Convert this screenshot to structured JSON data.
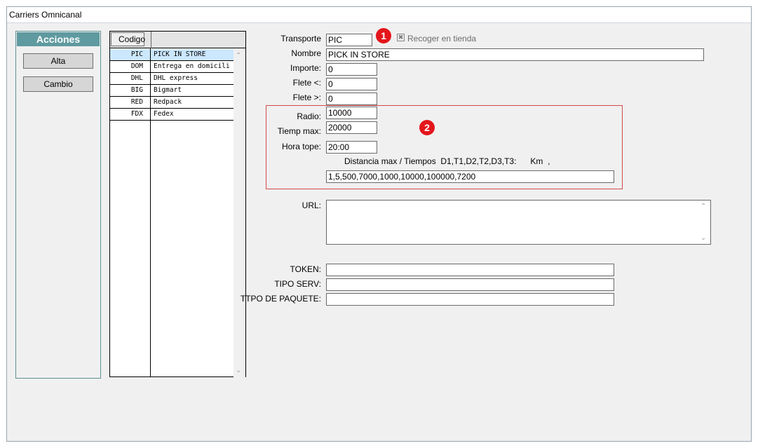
{
  "window": {
    "title": "Carriers Omnicanal"
  },
  "acciones": {
    "header": "Acciones",
    "buttons": {
      "alta": "Alta",
      "cambio": "Cambio"
    }
  },
  "list": {
    "column_header": "Codigo",
    "rows": [
      {
        "code": "PIC",
        "name": "PICK IN STORE"
      },
      {
        "code": "DOM",
        "name": "Entrega en domicili"
      },
      {
        "code": "DHL",
        "name": "DHL express"
      },
      {
        "code": "BIG",
        "name": "Bigmart"
      },
      {
        "code": "RED",
        "name": "Redpack"
      },
      {
        "code": "FDX",
        "name": "Fedex"
      }
    ],
    "selected_index": 0
  },
  "form": {
    "transporte": {
      "label": "Transporte",
      "value": "PIC"
    },
    "recoger": {
      "label": "Recoger en tienda",
      "checked": true
    },
    "nombre": {
      "label": "Nombre",
      "value": "PICK IN STORE"
    },
    "importe": {
      "label": "Importe:",
      "value": "0"
    },
    "flete_lt": {
      "label": "Flete <:",
      "value": "0"
    },
    "flete_gt": {
      "label": "Flete >:",
      "value": "0"
    },
    "radio": {
      "label": "Radio:",
      "value": "10000"
    },
    "tiemp_max": {
      "label": "Tiemp max:",
      "value": "20000"
    },
    "hora_tope": {
      "label": "Hora tope:",
      "value": "20:00"
    },
    "distancia": {
      "label": "Distancia max / Tiempos  D1,T1,D2,T2,D3,T3:      Km  ,",
      "value": "1,5,500,7000,1000,10000,100000,7200"
    },
    "url": {
      "label": "URL:",
      "value": ""
    },
    "token": {
      "label": "TOKEN:",
      "value": ""
    },
    "tipo_serv": {
      "label": "TIPO SERV:",
      "value": ""
    },
    "tipo_paquete": {
      "label": "TTPO DE PAQUETE:",
      "value": ""
    }
  },
  "annotations": {
    "badge1": "1",
    "badge2": "2",
    "badge_color": "#e4161c",
    "box_color": "#d44a4a"
  },
  "colors": {
    "acciones_header": "#5f9aa0",
    "selected_row": "#cce8ff"
  }
}
